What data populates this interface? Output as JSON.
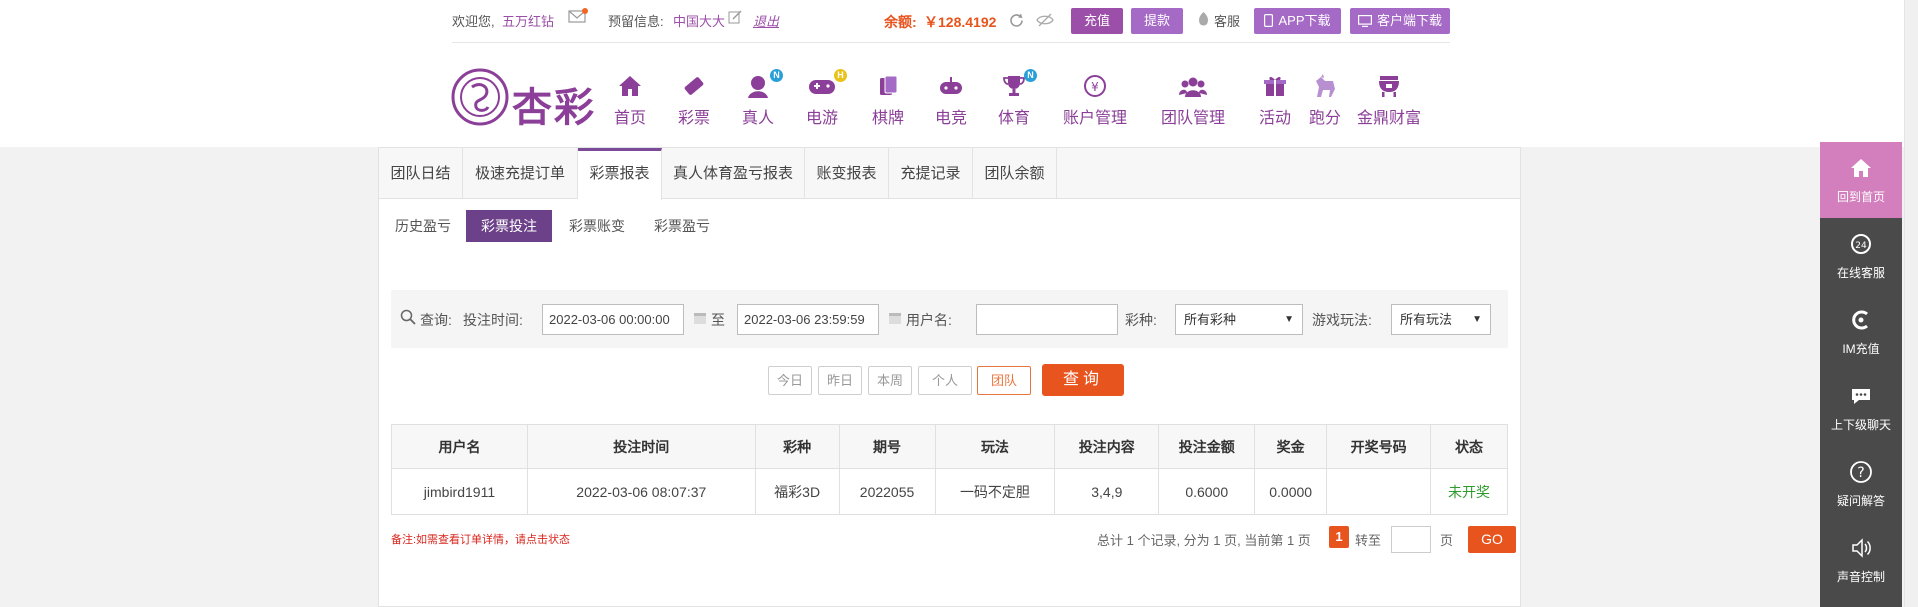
{
  "topbar": {
    "welcome_label": "欢迎您,",
    "username": "五万红钻",
    "reserve_label": "预留信息:",
    "reserve_value": "中国大大",
    "logout": "退出",
    "balance_label": "余额:",
    "balance_value": "￥128.4192",
    "recharge": "充值",
    "withdraw": "提款",
    "service": "客服",
    "app_download": "APP下载",
    "client_download": "客户端下载"
  },
  "logo": {
    "text": "杏彩"
  },
  "nav": [
    {
      "label": "首页",
      "icon": "home-icon"
    },
    {
      "label": "彩票",
      "icon": "ticket-icon"
    },
    {
      "label": "真人",
      "icon": "dealer-icon",
      "badge": "N"
    },
    {
      "label": "电游",
      "icon": "gamepad-icon",
      "badge": "H"
    },
    {
      "label": "棋牌",
      "icon": "cards-icon"
    },
    {
      "label": "电竞",
      "icon": "joystick-icon"
    },
    {
      "label": "体育",
      "icon": "trophy-icon",
      "badge": "N"
    },
    {
      "label": "账户管理",
      "icon": "account-icon"
    },
    {
      "label": "团队管理",
      "icon": "team-icon"
    },
    {
      "label": "活动",
      "icon": "gift-icon"
    },
    {
      "label": "跑分",
      "icon": "horse-icon"
    },
    {
      "label": "金鼎财富",
      "icon": "cauldron-icon"
    }
  ],
  "tabs": [
    "团队日结",
    "极速充提订单",
    "彩票报表",
    "真人体育盈亏报表",
    "账变报表",
    "充提记录",
    "团队余额"
  ],
  "active_tab": "彩票报表",
  "subtabs": [
    "历史盈亏",
    "彩票投注",
    "彩票账变",
    "彩票盈亏"
  ],
  "active_subtab": "彩票投注",
  "query": {
    "search_label": "查询:",
    "time_label": "投注时间:",
    "start_time": "2022-03-06 00:00:00",
    "to_label": "至",
    "end_time": "2022-03-06 23:59:59",
    "user_label": "用户名:",
    "user_value": "",
    "lottery_label": "彩种:",
    "lottery_value": "所有彩种",
    "play_label": "游戏玩法:",
    "play_value": "所有玩法"
  },
  "quick_buttons": [
    "今日",
    "昨日",
    "本周",
    "个人",
    "团队"
  ],
  "search_button": "查询",
  "table": {
    "headers": [
      "用户名",
      "投注时间",
      "彩种",
      "期号",
      "玩法",
      "投注内容",
      "投注金额",
      "奖金",
      "开奖号码",
      "状态"
    ],
    "rows": [
      [
        "jimbird1911",
        "2022-03-06 08:07:37",
        "福彩3D",
        "2022055",
        "一码不定胆",
        "3,4,9",
        "0.6000",
        "0.0000",
        "",
        "未开奖"
      ]
    ]
  },
  "note": "备注:如需查看订单详情，请点击状态",
  "pager": {
    "summary": "总计 1 个记录, 分为 1 页, 当前第 1 页",
    "current": "1",
    "goto_label": "转至",
    "page_label": "页",
    "go": "GO"
  },
  "rail": [
    {
      "label": "回到首页",
      "icon": "home-icon"
    },
    {
      "label": "在线客服",
      "icon": "support-24-icon"
    },
    {
      "label": "IM充值",
      "icon": "im-icon"
    },
    {
      "label": "上下级聊天",
      "icon": "chat-icon"
    },
    {
      "label": "疑问解答",
      "icon": "question-icon"
    },
    {
      "label": "声音控制",
      "icon": "speaker-icon"
    }
  ],
  "colors": {
    "brand_purple": "#8b3f98",
    "accent_orange": "#e8541e",
    "active_sub": "#6d4189",
    "rail_active": "#d47fbd",
    "status_green": "#2e9a2e"
  }
}
